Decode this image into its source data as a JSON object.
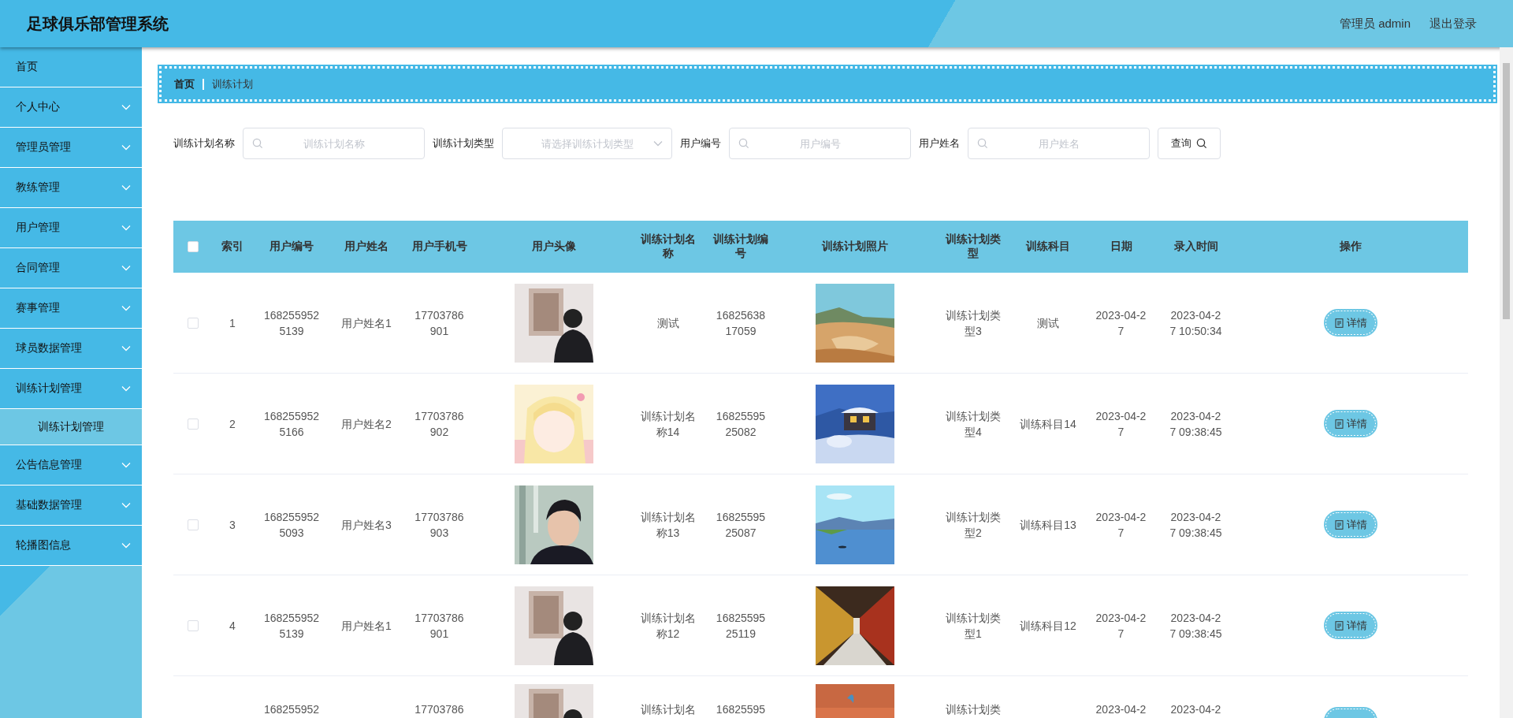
{
  "header": {
    "title": "足球俱乐部管理系统",
    "user_label": "管理员 admin",
    "logout": "退出登录"
  },
  "sidebar": {
    "items": [
      {
        "label": "首页",
        "kind": "link"
      },
      {
        "label": "个人中心",
        "kind": "menu"
      },
      {
        "label": "管理员管理",
        "kind": "menu"
      },
      {
        "label": "教练管理",
        "kind": "menu"
      },
      {
        "label": "用户管理",
        "kind": "menu"
      },
      {
        "label": "合同管理",
        "kind": "menu"
      },
      {
        "label": "赛事管理",
        "kind": "menu"
      },
      {
        "label": "球员数据管理",
        "kind": "menu"
      },
      {
        "label": "训练计划管理",
        "kind": "menu",
        "children": [
          {
            "label": "训练计划管理"
          }
        ]
      },
      {
        "label": "公告信息管理",
        "kind": "menu"
      },
      {
        "label": "基础数据管理",
        "kind": "menu"
      },
      {
        "label": "轮播图信息",
        "kind": "menu"
      }
    ]
  },
  "breadcrumb": [
    {
      "label": "首页",
      "kind": "link"
    },
    {
      "label": "训练计划",
      "kind": "current"
    }
  ],
  "search": {
    "fields": [
      {
        "label": "训练计划名称",
        "kind": "text",
        "placeholder": "训练计划名称"
      },
      {
        "label": "训练计划类型",
        "kind": "select",
        "placeholder": "请选择训练计划类型"
      },
      {
        "label": "用户编号",
        "kind": "text",
        "placeholder": "用户编号"
      },
      {
        "label": "用户姓名",
        "kind": "text",
        "placeholder": "用户姓名"
      }
    ],
    "button": "查询"
  },
  "table": {
    "select_all": {
      "checked": false
    },
    "columns": [
      "索引",
      "用户编号",
      "用户姓名",
      "用户手机号",
      "用户头像",
      "训练计划名称",
      "训练计划编号",
      "训练计划照片",
      "训练计划类型",
      "训练科目",
      "日期",
      "录入时间",
      "操作"
    ],
    "rows": [
      {
        "checked": false,
        "index": "1",
        "user_id": "1682559525139",
        "user_name": "用户姓名1",
        "phone": "17703786901",
        "plan_name": "测试",
        "plan_no": "1682563817059",
        "plan_type": "训练计划类型3",
        "subject": "测试",
        "date": "2023-04-27",
        "created": "2023-04-27 10:50:34",
        "action": "详情"
      },
      {
        "checked": false,
        "index": "2",
        "user_id": "1682559525166",
        "user_name": "用户姓名2",
        "phone": "17703786902",
        "plan_name": "训练计划名称14",
        "plan_no": "1682559525082",
        "plan_type": "训练计划类型4",
        "subject": "训练科目14",
        "date": "2023-04-27",
        "created": "2023-04-27 09:38:45",
        "action": "详情"
      },
      {
        "checked": false,
        "index": "3",
        "user_id": "1682559525093",
        "user_name": "用户姓名3",
        "phone": "17703786903",
        "plan_name": "训练计划名称13",
        "plan_no": "1682559525087",
        "plan_type": "训练计划类型2",
        "subject": "训练科目13",
        "date": "2023-04-27",
        "created": "2023-04-27 09:38:45",
        "action": "详情"
      },
      {
        "checked": false,
        "index": "4",
        "user_id": "1682559525139",
        "user_name": "用户姓名1",
        "phone": "17703786901",
        "plan_name": "训练计划名称12",
        "plan_no": "1682559525119",
        "plan_type": "训练计划类型1",
        "subject": "训练科目12",
        "date": "2023-04-27",
        "created": "2023-04-27 09:38:45",
        "action": "详情"
      },
      {
        "partial": true,
        "user_id": "168255952",
        "phone": "17703786",
        "plan_name": "训练计划名",
        "plan_no": "16825595",
        "plan_type": "训练计划类",
        "date": "2023-04-2",
        "created": "2023-04-2"
      }
    ]
  }
}
